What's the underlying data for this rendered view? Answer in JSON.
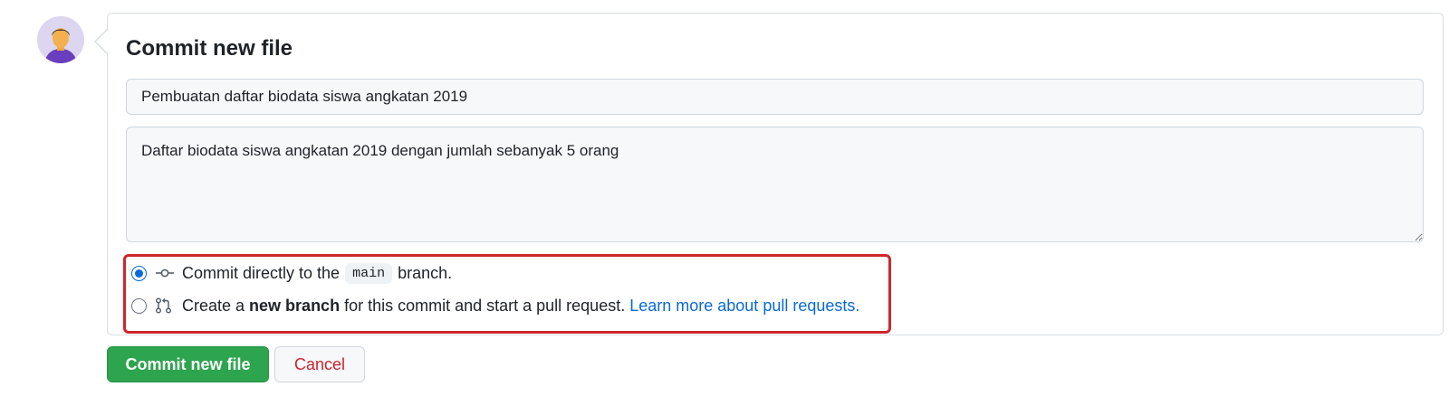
{
  "commit": {
    "title": "Commit new file",
    "summary_value": "Pembuatan daftar biodata siswa angkatan 2019",
    "description_value": "Daftar biodata siswa angkatan 2019 dengan jumlah sebanyak 5 orang"
  },
  "options": {
    "direct": {
      "selected": true,
      "icon": "git-commit-icon",
      "text_before": "Commit directly to the",
      "branch_name": "main",
      "text_after": "branch."
    },
    "new_branch": {
      "selected": false,
      "icon": "git-pull-request-icon",
      "text_before": "Create a",
      "bold_text": "new branch",
      "text_after": "for this commit and start a pull request.",
      "link_text": "Learn more about pull requests."
    }
  },
  "buttons": {
    "commit_label": "Commit new file",
    "cancel_label": "Cancel"
  },
  "colors": {
    "primary_green": "#2da44e",
    "link_blue": "#0969da",
    "danger_red": "#cf222e",
    "highlight_red": "#d0262c"
  }
}
